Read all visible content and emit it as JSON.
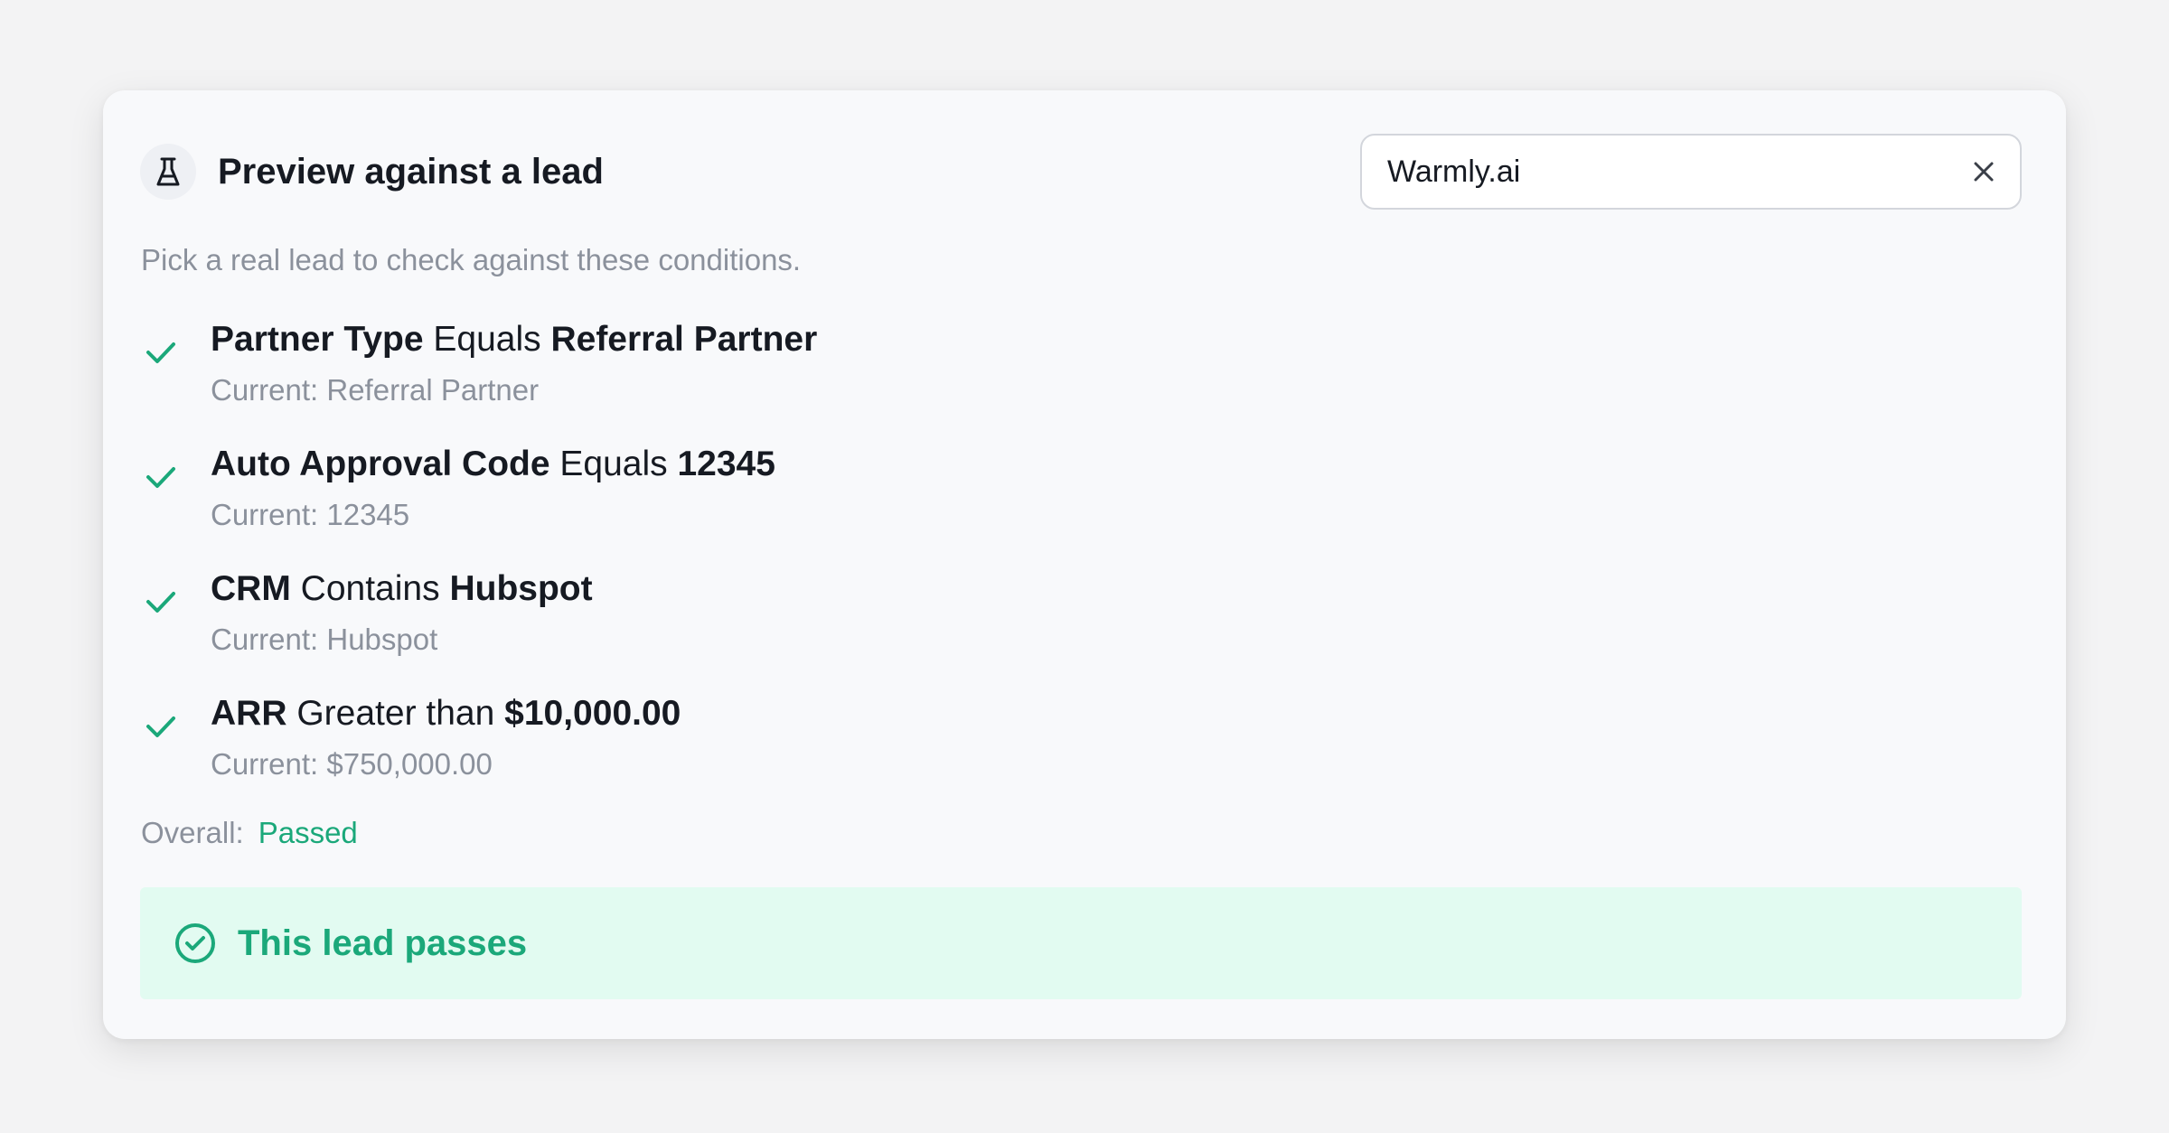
{
  "header": {
    "icon": "flask-icon",
    "title": "Preview against a lead"
  },
  "search": {
    "value": "Warmly.ai",
    "placeholder": "",
    "clear_icon": "close-icon"
  },
  "subtitle": "Pick a real lead to check against these conditions.",
  "conditions": [
    {
      "field": "Partner Type",
      "operator": "Equals",
      "value": "Referral Partner",
      "current": "Current: Referral Partner",
      "icon": "check-icon"
    },
    {
      "field": "Auto Approval Code",
      "operator": "Equals",
      "value": "12345",
      "current": "Current: 12345",
      "icon": "check-icon"
    },
    {
      "field": "CRM",
      "operator": "Contains",
      "value": "Hubspot",
      "current": "Current: Hubspot",
      "icon": "check-icon"
    },
    {
      "field": "ARR",
      "operator": "Greater than",
      "value": "$10,000.00",
      "current": "Current: $750,000.00",
      "icon": "check-icon"
    }
  ],
  "overall": {
    "label": "Overall:",
    "value": "Passed"
  },
  "result": {
    "icon": "check-circle-icon",
    "text": "This lead passes"
  },
  "colors": {
    "success": "#1ba87a",
    "success_bg": "#e2fbf1",
    "text_primary": "#161a22",
    "text_muted": "#8b919c"
  }
}
